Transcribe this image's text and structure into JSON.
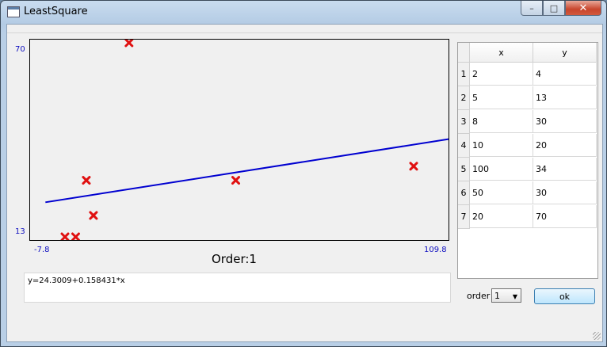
{
  "window": {
    "title": "LeastSquare",
    "title_icon": "app-window-icon"
  },
  "window_controls": {
    "minimize": "–",
    "maximize": "□",
    "close": "✕"
  },
  "menubar": {
    "items": []
  },
  "plot": {
    "y_axis_labels": {
      "top": "70",
      "bottom": "13"
    },
    "x_axis_labels": {
      "left": "-7.8",
      "right": "109.8"
    },
    "caption": "Order:1",
    "colors": {
      "points": "#e01010",
      "fit_line": "#0000d0",
      "axis_labels": "#1010c0"
    }
  },
  "chart_data": {
    "type": "scatter",
    "x": [
      2,
      5,
      8,
      10,
      100,
      50,
      20
    ],
    "y": [
      4,
      13,
      30,
      20,
      34,
      30,
      70
    ],
    "xlim": [
      -7.8,
      109.8
    ],
    "ylim": [
      13,
      70
    ],
    "fit": {
      "intercept": 24.3009,
      "slope": 0.158431
    },
    "grid": false
  },
  "equation": {
    "text": "y=24.3009+0.158431*x"
  },
  "table": {
    "columns": [
      "x",
      "y"
    ],
    "rows": [
      {
        "num": "1",
        "x": "2",
        "y": "4"
      },
      {
        "num": "2",
        "x": "5",
        "y": "13"
      },
      {
        "num": "3",
        "x": "8",
        "y": "30"
      },
      {
        "num": "4",
        "x": "10",
        "y": "20"
      },
      {
        "num": "5",
        "x": "100",
        "y": "34"
      },
      {
        "num": "6",
        "x": "50",
        "y": "30"
      },
      {
        "num": "7",
        "x": "20",
        "y": "70"
      }
    ]
  },
  "controls": {
    "order_label": "order",
    "order_value": "1",
    "ok_label": "ok"
  }
}
